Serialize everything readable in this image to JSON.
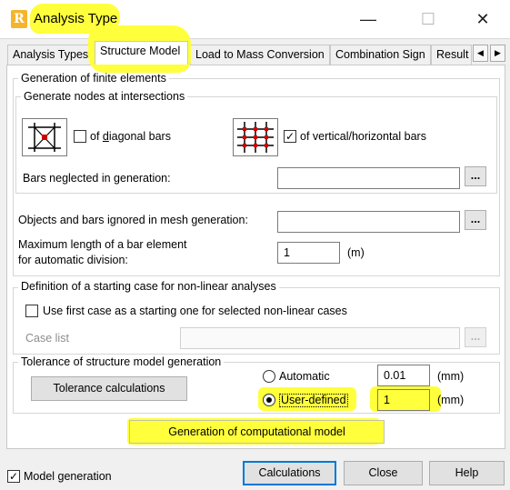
{
  "window": {
    "title": "Analysis Type",
    "app_icon_letter": "R",
    "minimize_glyph": "—",
    "maximize_glyph": "☐",
    "close_glyph": "✕"
  },
  "tabs": [
    {
      "label": "Analysis Types"
    },
    {
      "label": "Structure Model"
    },
    {
      "label": "Load to Mass Conversion"
    },
    {
      "label": "Combination Sign"
    },
    {
      "label": "Result"
    }
  ],
  "tab_scroll": {
    "left": "◀",
    "right": "▶"
  },
  "finite": {
    "title": "Generation of finite elements",
    "intersections": {
      "title": "Generate nodes at intersections",
      "diagonal": {
        "label_pre": "of ",
        "label_key": "d",
        "label_post": "iagonal bars",
        "checked": false
      },
      "vertical": {
        "label": "of vertical/horizontal bars",
        "checked": true,
        "check_glyph": "✓"
      },
      "neglected_label": "Bars neglected in generation:",
      "neglected_value": "",
      "dots": "..."
    },
    "ignored_label": "Objects and bars ignored in mesh generation:",
    "ignored_value": "",
    "dots": "...",
    "maxlen_line1": "Maximum length of a bar element",
    "maxlen_line2": "for automatic division:",
    "maxlen_value": "1",
    "maxlen_unit": "(m)"
  },
  "starting": {
    "title": "Definition of a starting case for non-linear analyses",
    "use_first": "Use first case as a starting one for selected non-linear cases",
    "case_list": "Case list",
    "case_value": "",
    "dots": "..."
  },
  "tolerance": {
    "title": "Tolerance of structure model generation",
    "calc_button": "Tolerance calculations",
    "automatic": {
      "label": "Automatic",
      "value": "0.01",
      "unit": "(mm)"
    },
    "user_defined": {
      "label": "User-defined",
      "value": "1",
      "unit": "(mm)"
    }
  },
  "generate_button": "Generation of computational model",
  "footer": {
    "model_generation": "Model generation",
    "model_check_glyph": "✓",
    "calculations": "Calculations",
    "close": "Close",
    "help": "Help"
  },
  "colors": {
    "highlight": "#ffff3c",
    "accent": "#0078d7",
    "node_red": "#d40000"
  }
}
